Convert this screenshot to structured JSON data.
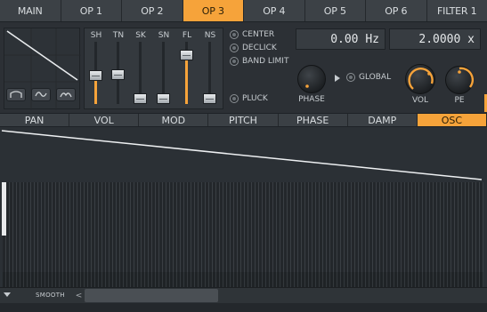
{
  "top_tabs": [
    {
      "label": "MAIN",
      "active": false
    },
    {
      "label": "OP 1",
      "active": false
    },
    {
      "label": "OP 2",
      "active": false
    },
    {
      "label": "OP 3",
      "active": true
    },
    {
      "label": "OP 4",
      "active": false
    },
    {
      "label": "OP 5",
      "active": false
    },
    {
      "label": "OP 6",
      "active": false
    },
    {
      "label": "FILTER 1",
      "active": false
    }
  ],
  "sliders": [
    {
      "label": "SH",
      "level": 0.45,
      "filled": true
    },
    {
      "label": "TN",
      "level": 0.47,
      "filled": false
    },
    {
      "label": "SK",
      "level": 0.0,
      "filled": false
    },
    {
      "label": "SN",
      "level": 0.0,
      "filled": false
    },
    {
      "label": "FL",
      "level": 0.85,
      "filled": true
    },
    {
      "label": "NS",
      "level": 0.0,
      "filled": false
    }
  ],
  "options": {
    "center": "CENTER",
    "declick": "DECLICK",
    "band_limit": "BAND LIMIT",
    "pluck": "PLUCK",
    "global": "GLOBAL"
  },
  "displays": {
    "frequency": "0.00 Hz",
    "ratio": "2.0000 x"
  },
  "knobs": {
    "phase_label": "PHASE",
    "vol_label": "VOL",
    "pe_label": "PE"
  },
  "mod_tabs": [
    {
      "label": "PAN",
      "active": false
    },
    {
      "label": "VOL",
      "active": false
    },
    {
      "label": "MOD",
      "active": false
    },
    {
      "label": "PITCH",
      "active": false
    },
    {
      "label": "PHASE",
      "active": false
    },
    {
      "label": "DAMP",
      "active": false
    },
    {
      "label": "OSC",
      "active": true
    }
  ],
  "bottom": {
    "smooth_label": "SMOOTH",
    "scroll_left": "<"
  },
  "colors": {
    "accent": "#f6a33a",
    "background": "#2c3035",
    "panel": "#3b4045"
  },
  "icons": [
    "saw-shape-icon",
    "sine-shape-icon",
    "wave-shape-icon",
    "chevron-right-icon",
    "chevron-down-icon",
    "chevron-left-icon"
  ]
}
